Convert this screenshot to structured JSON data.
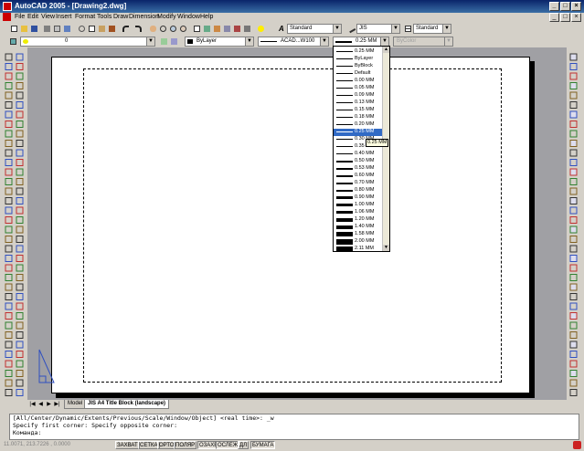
{
  "window": {
    "title": "AutoCAD 2005 - [Drawing2.dwg]",
    "min": "_",
    "max": "□",
    "close": "×"
  },
  "menu": [
    "File",
    "Edit",
    "View",
    "Insert",
    "Format",
    "Tools",
    "Draw",
    "Dimension",
    "Modify",
    "Window",
    "Help"
  ],
  "styles_toolbar": {
    "text_style": "Standard",
    "dim_style": "JIS",
    "table_style": "Standard"
  },
  "layers_toolbar": {
    "layer": "0"
  },
  "properties_toolbar": {
    "color": "ByLayer",
    "linetype": "ACAD...W100",
    "lineweight": "0.25 MM",
    "plotstyle": "ByColor"
  },
  "lineweight_list": {
    "items": [
      "0.25 MM",
      "ByLayer",
      "ByBlock",
      "Default",
      "0.00 MM",
      "0.05 MM",
      "0.09 MM",
      "0.13 MM",
      "0.15 MM",
      "0.18 MM",
      "0.20 MM",
      "0.25 MM",
      "0.30 MM",
      "0.35 MM",
      "0.40 MM",
      "0.50 MM",
      "0.53 MM",
      "0.60 MM",
      "0.70 MM",
      "0.80 MM",
      "0.90 MM",
      "1.00 MM",
      "1.06 MM",
      "1.20 MM",
      "1.40 MM",
      "1.58 MM",
      "2.00 MM",
      "2.11 MM"
    ],
    "selected_index": 11,
    "tooltip": "0.25 MM"
  },
  "layout_tabs": [
    "Model",
    "JIS A4 Title Block (landscape)"
  ],
  "command_window": [
    "[All/Center/Dynamic/Extents/Previous/Scale/Window/Object] <real time>: _w",
    "Specify first corner: Specify opposite corner:",
    "Команда:"
  ],
  "status": {
    "coords": "11.0071, 213.7226 , 0.0000",
    "buttons": [
      "ЗАХВАТ",
      "СЕТКА",
      "ОРТО",
      "ПОЛЯР",
      "ОЗАХВ",
      "ОСЛЕЖ",
      "ДЛ",
      "БУМАГА"
    ],
    "active": [
      4,
      5,
      7
    ]
  },
  "colors": {
    "titlebar": "#0a246a",
    "selection": "#316ac5",
    "background": "#a0a0a4"
  }
}
